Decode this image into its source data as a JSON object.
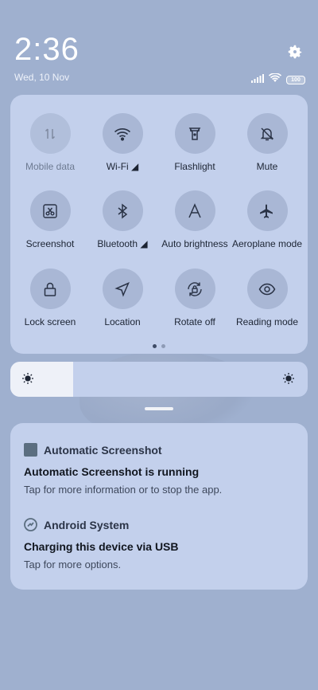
{
  "status": {
    "time": "2:36",
    "date": "Wed, 10 Nov",
    "battery": "100"
  },
  "quick_settings": {
    "tiles": [
      {
        "label": "Mobile data",
        "icon": "mobile-data-icon",
        "active": false
      },
      {
        "label": "Wi-Fi ◢",
        "icon": "wifi-icon",
        "active": true
      },
      {
        "label": "Flashlight",
        "icon": "flashlight-icon",
        "active": true
      },
      {
        "label": "Mute",
        "icon": "mute-bell-icon",
        "active": true
      },
      {
        "label": "Screenshot",
        "icon": "screenshot-icon",
        "active": true
      },
      {
        "label": "Bluetooth ◢",
        "icon": "bluetooth-icon",
        "active": true
      },
      {
        "label": "Auto brightness",
        "icon": "auto-brightness-icon",
        "active": true
      },
      {
        "label": "Aeroplane mode",
        "icon": "aeroplane-icon",
        "active": true
      },
      {
        "label": "Lock screen",
        "icon": "lock-icon",
        "active": true
      },
      {
        "label": "Location",
        "icon": "location-icon",
        "active": true
      },
      {
        "label": "Rotate off",
        "icon": "rotate-lock-icon",
        "active": true
      },
      {
        "label": "Reading mode",
        "icon": "eye-icon",
        "active": true
      }
    ],
    "page_count": 2,
    "current_page": 1
  },
  "brightness": {
    "level": 0.21
  },
  "notifications": [
    {
      "app": "Automatic Screenshot",
      "title": "Automatic Screenshot is running",
      "body": "Tap for more information or to stop the app."
    },
    {
      "app": "Android System",
      "title": "Charging this device via USB",
      "body": "Tap for more options."
    }
  ],
  "colors": {
    "background": "#9fb0cf",
    "panel": "#c3d0ec",
    "tile": "#a9b7d5"
  }
}
